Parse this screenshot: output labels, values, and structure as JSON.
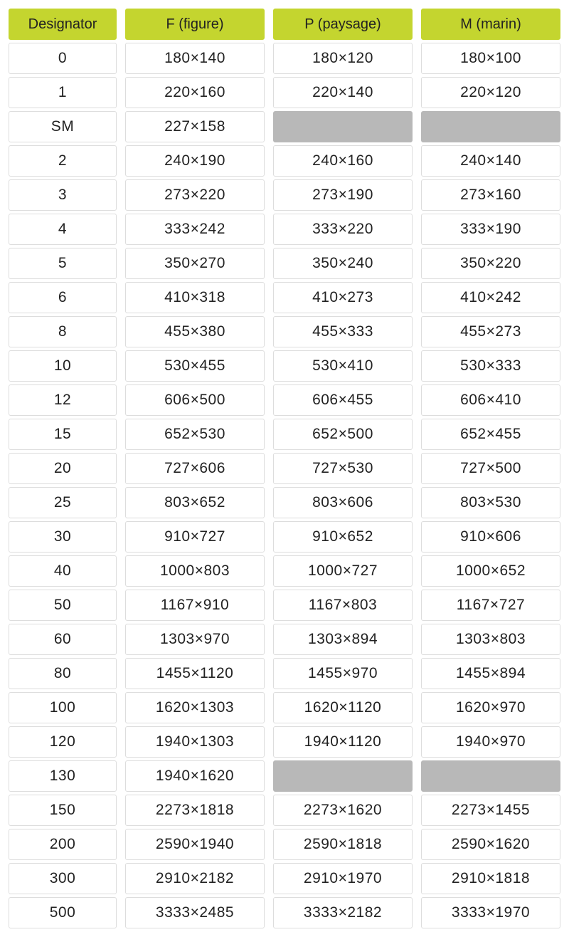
{
  "table": {
    "headers": [
      "Designator",
      "F (figure)",
      "P (paysage)",
      "M (marin)"
    ],
    "rows": [
      {
        "designator": "0",
        "f": "180×140",
        "p": "180×120",
        "m": "180×100"
      },
      {
        "designator": "1",
        "f": "220×160",
        "p": "220×140",
        "m": "220×120"
      },
      {
        "designator": "SM",
        "f": "227×158",
        "p": null,
        "m": null
      },
      {
        "designator": "2",
        "f": "240×190",
        "p": "240×160",
        "m": "240×140"
      },
      {
        "designator": "3",
        "f": "273×220",
        "p": "273×190",
        "m": "273×160"
      },
      {
        "designator": "4",
        "f": "333×242",
        "p": "333×220",
        "m": "333×190"
      },
      {
        "designator": "5",
        "f": "350×270",
        "p": "350×240",
        "m": "350×220"
      },
      {
        "designator": "6",
        "f": "410×318",
        "p": "410×273",
        "m": "410×242"
      },
      {
        "designator": "8",
        "f": "455×380",
        "p": "455×333",
        "m": "455×273"
      },
      {
        "designator": "10",
        "f": "530×455",
        "p": "530×410",
        "m": "530×333"
      },
      {
        "designator": "12",
        "f": "606×500",
        "p": "606×455",
        "m": "606×410"
      },
      {
        "designator": "15",
        "f": "652×530",
        "p": "652×500",
        "m": "652×455"
      },
      {
        "designator": "20",
        "f": "727×606",
        "p": "727×530",
        "m": "727×500"
      },
      {
        "designator": "25",
        "f": "803×652",
        "p": "803×606",
        "m": "803×530"
      },
      {
        "designator": "30",
        "f": "910×727",
        "p": "910×652",
        "m": "910×606"
      },
      {
        "designator": "40",
        "f": "1000×803",
        "p": "1000×727",
        "m": "1000×652"
      },
      {
        "designator": "50",
        "f": "1167×910",
        "p": "1167×803",
        "m": "1167×727"
      },
      {
        "designator": "60",
        "f": "1303×970",
        "p": "1303×894",
        "m": "1303×803"
      },
      {
        "designator": "80",
        "f": "1455×1120",
        "p": "1455×970",
        "m": "1455×894"
      },
      {
        "designator": "100",
        "f": "1620×1303",
        "p": "1620×1120",
        "m": "1620×970"
      },
      {
        "designator": "120",
        "f": "1940×1303",
        "p": "1940×1120",
        "m": "1940×970"
      },
      {
        "designator": "130",
        "f": "1940×1620",
        "p": null,
        "m": null
      },
      {
        "designator": "150",
        "f": "2273×1818",
        "p": "2273×1620",
        "m": "2273×1455"
      },
      {
        "designator": "200",
        "f": "2590×1940",
        "p": "2590×1818",
        "m": "2590×1620"
      },
      {
        "designator": "300",
        "f": "2910×2182",
        "p": "2910×1970",
        "m": "2910×1818"
      },
      {
        "designator": "500",
        "f": "3333×2485",
        "p": "3333×2182",
        "m": "3333×1970"
      }
    ]
  }
}
